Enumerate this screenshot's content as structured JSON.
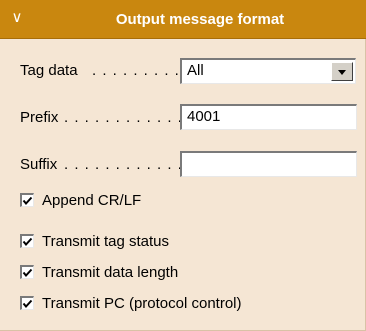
{
  "header": {
    "title": "Output message format",
    "collapse_icon": "chevron-down-icon",
    "chevron_glyph": "∨"
  },
  "colors": {
    "header_bg": "#c9870f",
    "panel_bg": "#f5e6d4"
  },
  "tag_data": {
    "label": "Tag data",
    "dots": ". . . . . . . . .",
    "value": "All"
  },
  "prefix": {
    "label": "Prefix",
    "dots": ". . . . . . . . . . . .",
    "value": "4001"
  },
  "suffix": {
    "label": "Suffix",
    "dots": ". . . . . . . . . . . .",
    "value": ""
  },
  "checkboxes": {
    "append_crlf": {
      "label": "Append CR/LF",
      "checked": true
    },
    "transmit_tag_status": {
      "label": "Transmit tag status",
      "checked": true
    },
    "transmit_data_length": {
      "label": "Transmit data length",
      "checked": true
    },
    "transmit_pc": {
      "label": "Transmit PC (protocol control)",
      "checked": true
    }
  }
}
